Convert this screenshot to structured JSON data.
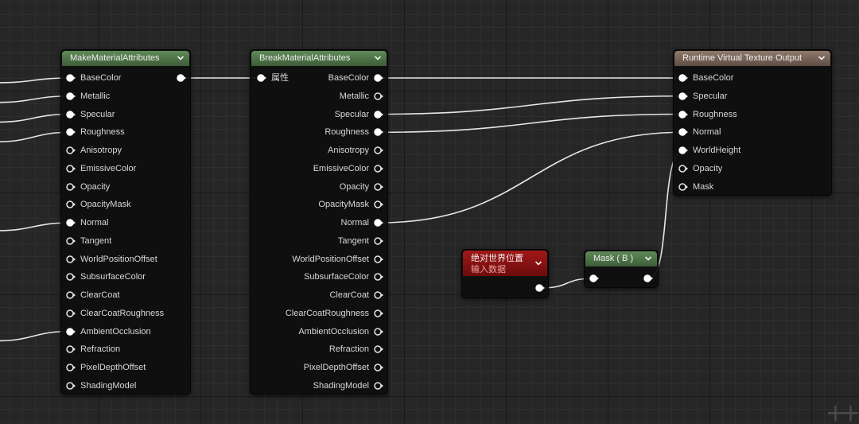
{
  "nodes": {
    "make": {
      "title": "MakeMaterialAttributes",
      "inputs": [
        {
          "label": "BaseColor",
          "connected": true
        },
        {
          "label": "Metallic",
          "connected": true
        },
        {
          "label": "Specular",
          "connected": true
        },
        {
          "label": "Roughness",
          "connected": true
        },
        {
          "label": "Anisotropy",
          "connected": false
        },
        {
          "label": "EmissiveColor",
          "connected": false
        },
        {
          "label": "Opacity",
          "connected": false
        },
        {
          "label": "OpacityMask",
          "connected": false
        },
        {
          "label": "Normal",
          "connected": true
        },
        {
          "label": "Tangent",
          "connected": false
        },
        {
          "label": "WorldPositionOffset",
          "connected": false
        },
        {
          "label": "SubsurfaceColor",
          "connected": false
        },
        {
          "label": "ClearCoat",
          "connected": false
        },
        {
          "label": "ClearCoatRoughness",
          "connected": false
        },
        {
          "label": "AmbientOcclusion",
          "connected": true
        },
        {
          "label": "Refraction",
          "connected": false
        },
        {
          "label": "PixelDepthOffset",
          "connected": false
        },
        {
          "label": "ShadingModel",
          "connected": false
        }
      ]
    },
    "break": {
      "title": "BreakMaterialAttributes",
      "input_label": "属性",
      "outputs": [
        {
          "label": "BaseColor",
          "connected": true
        },
        {
          "label": "Metallic",
          "connected": false
        },
        {
          "label": "Specular",
          "connected": true
        },
        {
          "label": "Roughness",
          "connected": true
        },
        {
          "label": "Anisotropy",
          "connected": false
        },
        {
          "label": "EmissiveColor",
          "connected": false
        },
        {
          "label": "Opacity",
          "connected": false
        },
        {
          "label": "OpacityMask",
          "connected": false
        },
        {
          "label": "Normal",
          "connected": true
        },
        {
          "label": "Tangent",
          "connected": false
        },
        {
          "label": "WorldPositionOffset",
          "connected": false
        },
        {
          "label": "SubsurfaceColor",
          "connected": false
        },
        {
          "label": "ClearCoat",
          "connected": false
        },
        {
          "label": "ClearCoatRoughness",
          "connected": false
        },
        {
          "label": "AmbientOcclusion",
          "connected": false
        },
        {
          "label": "Refraction",
          "connected": false
        },
        {
          "label": "PixelDepthOffset",
          "connected": false
        },
        {
          "label": "ShadingModel",
          "connected": false
        }
      ]
    },
    "output": {
      "title": "Runtime Virtual Texture Output",
      "inputs": [
        {
          "label": "BaseColor",
          "connected": true
        },
        {
          "label": "Specular",
          "connected": true
        },
        {
          "label": "Roughness",
          "connected": true
        },
        {
          "label": "Normal",
          "connected": true
        },
        {
          "label": "WorldHeight",
          "connected": true
        },
        {
          "label": "Opacity",
          "connected": false
        },
        {
          "label": "Mask",
          "connected": false
        }
      ]
    },
    "worldpos": {
      "title": "绝对世界位置",
      "subtitle": "输入数据"
    },
    "mask": {
      "title": "Mask ( B )"
    }
  },
  "colors": {
    "header_green": "#4f7548",
    "header_tan": "#7a665a",
    "header_red": "#8a1414",
    "wire": "#e6e6e6",
    "background": "#262626"
  },
  "icons": {
    "collapse": "chevron-down-icon",
    "pin": "exec-pin-icon",
    "zoom": "zoom-indicator"
  }
}
